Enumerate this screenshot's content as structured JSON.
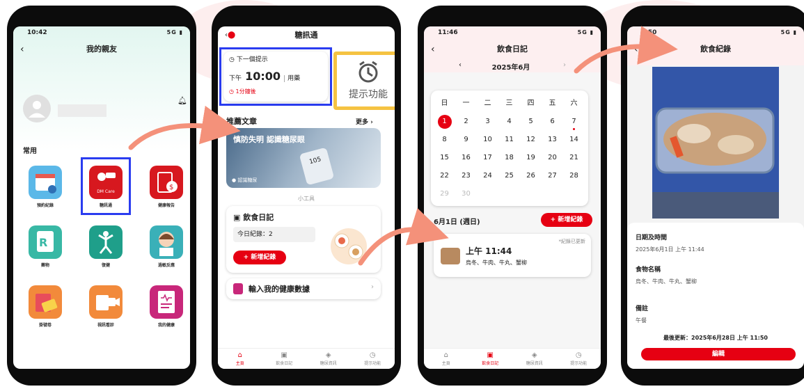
{
  "phone1": {
    "time": "10:42",
    "signal": "5G",
    "title": "我的親友",
    "section": "常用",
    "apps": [
      {
        "label": "預約紀錄"
      },
      {
        "label": "糖訊通",
        "badge": "DM Care"
      },
      {
        "label": "健康報告"
      },
      {
        "label": "藥物"
      },
      {
        "label": "復健"
      },
      {
        "label": "過敏反應"
      },
      {
        "label": "掛號卷"
      },
      {
        "label": "視訊看診"
      },
      {
        "label": "我的健康"
      }
    ]
  },
  "phone2": {
    "title": "糖訊通",
    "reminder_label": "下一個提示",
    "reminder_ampm": "下午",
    "reminder_time": "10:00",
    "reminder_type": "用藥",
    "reminder_countdown": "1分鐘後",
    "reminder_callout": "提示功能",
    "articles_title": "推薦文章",
    "articles_more": "更多",
    "article_headline": "慎防失明 認識糖尿眼",
    "article_meter": "105",
    "article_tag": "認識糖尿",
    "tools_title": "小工具",
    "diary_title": "飲食日記",
    "diary_count": "今日紀錄：2",
    "diary_add": "+ 新增紀錄",
    "health_input": "輸入我的健康數據"
  },
  "phone3": {
    "time": "11:46",
    "signal": "5G",
    "title": "飲食日記",
    "month": "2025年6月",
    "weekdays": [
      "日",
      "一",
      "二",
      "三",
      "四",
      "五",
      "六"
    ],
    "weeks": [
      [
        "1",
        "2",
        "3",
        "4",
        "5",
        "6",
        "7"
      ],
      [
        "8",
        "9",
        "10",
        "11",
        "12",
        "13",
        "14"
      ],
      [
        "15",
        "16",
        "17",
        "18",
        "19",
        "20",
        "21"
      ],
      [
        "22",
        "23",
        "24",
        "25",
        "26",
        "27",
        "28"
      ],
      [
        "29",
        "30",
        "",
        "",
        "",
        "",
        ""
      ]
    ],
    "selected_date": "6月1日 (週日)",
    "add_button": "+ 新增紀錄",
    "entry_note": "*紀錄已更新",
    "entry_time": "上午 11:44",
    "entry_food": "烏冬、牛肉、牛丸、蟹柳"
  },
  "phone4": {
    "time": "1:50",
    "signal": "5G",
    "title": "飲食紀錄",
    "date_label": "日期及時間",
    "date_value": "2025年6月1日 上午 11:44",
    "food_label": "食物名稱",
    "food_value": "烏冬、牛肉、牛丸、蟹柳",
    "note_label": "備註",
    "note_value": "午餐",
    "updated": "最後更新：2025年6月28日 上午 11:50",
    "edit_button": "編輯"
  },
  "tabs_p2": [
    "主頁",
    "飲食日記",
    "糖尿資訊",
    "提示功能"
  ],
  "tabs_p3": [
    "主頁",
    "飲食日記",
    "糖尿資訊",
    "提示功能"
  ],
  "colors": {
    "accent": "#e60012",
    "highlight_blue": "#2a3cf0",
    "callout_yellow": "#f5c342",
    "arrow": "#f4917a"
  }
}
